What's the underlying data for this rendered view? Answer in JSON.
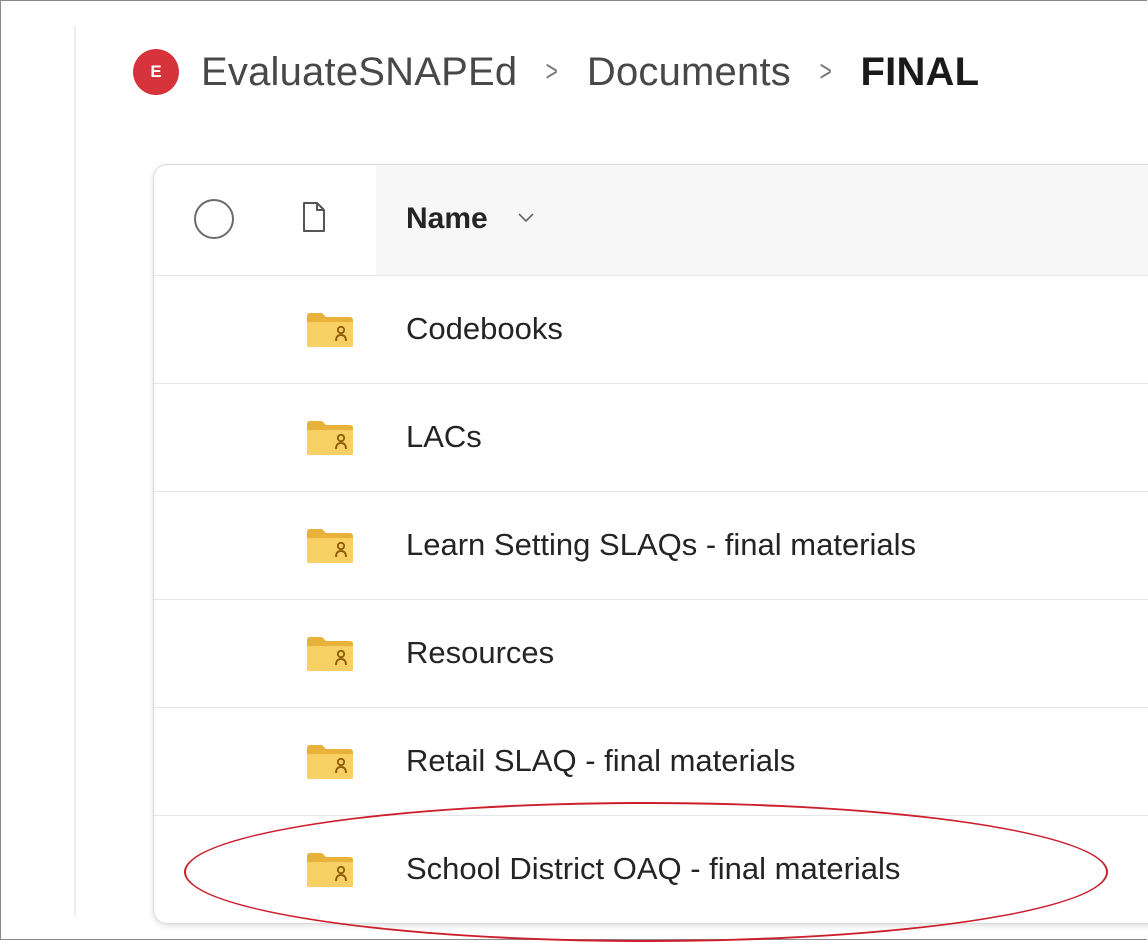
{
  "breadcrumb": {
    "site_initial": "E",
    "site_name": "EvaluateSNAPEd",
    "library": "Documents",
    "current": "FINAL",
    "separator": ">"
  },
  "list": {
    "header": {
      "name_label": "Name"
    },
    "items": [
      {
        "name": "Codebooks",
        "type": "shared-folder"
      },
      {
        "name": "LACs",
        "type": "shared-folder"
      },
      {
        "name": "Learn Setting SLAQs - final materials",
        "type": "shared-folder"
      },
      {
        "name": "Resources",
        "type": "shared-folder"
      },
      {
        "name": "Retail SLAQ - final materials",
        "type": "shared-folder"
      },
      {
        "name": "School District OAQ - final materials",
        "type": "shared-folder",
        "highlighted": true
      }
    ]
  },
  "colors": {
    "site_badge": "#d6333d",
    "folder": "#f4c84d",
    "highlight_ring": "#cc1f2b"
  }
}
